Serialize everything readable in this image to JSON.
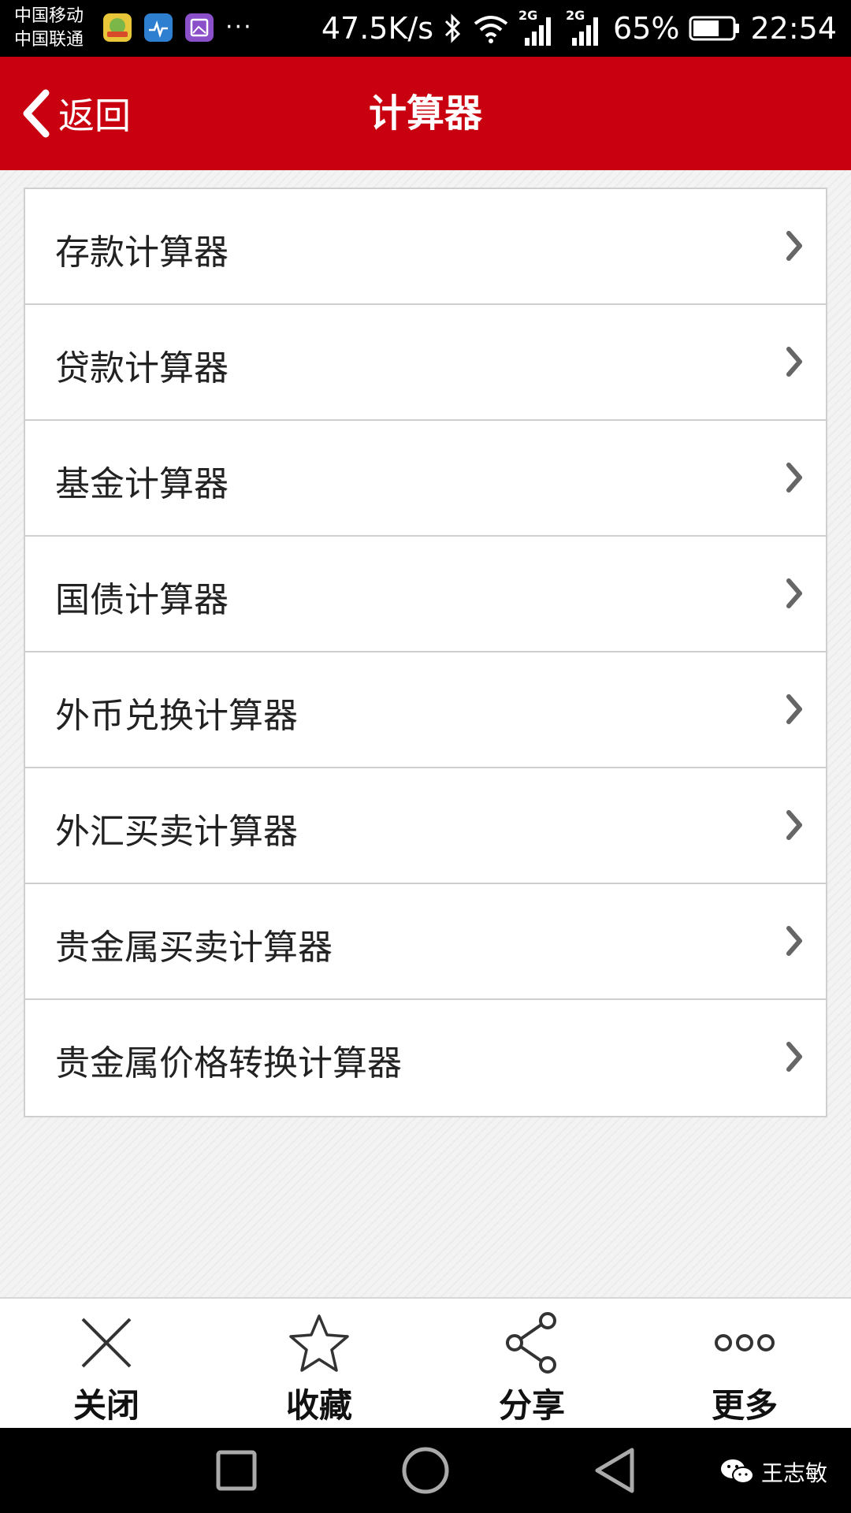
{
  "status_bar": {
    "carrier_1": "中国移动",
    "carrier_2": "中国联通",
    "more_dots": "···",
    "net_speed": "47.5K/s",
    "signal_1_label": "2G",
    "signal_2_label": "2G",
    "battery_percent": "65%",
    "time": "22:54"
  },
  "header": {
    "back_label": "返回",
    "title": "计算器"
  },
  "menu": {
    "items": [
      {
        "label": "存款计算器"
      },
      {
        "label": "贷款计算器"
      },
      {
        "label": "基金计算器"
      },
      {
        "label": "国债计算器"
      },
      {
        "label": "外币兑换计算器"
      },
      {
        "label": "外汇买卖计算器"
      },
      {
        "label": "贵金属买卖计算器"
      },
      {
        "label": "贵金属价格转换计算器"
      }
    ]
  },
  "actions": {
    "close_label": "关闭",
    "favorite_label": "收藏",
    "share_label": "分享",
    "more_label": "更多"
  },
  "watermark": {
    "text": "王志敏"
  },
  "colors": {
    "header_bg": "#c8000f",
    "status_bg": "#000000",
    "nav_bg": "#000000"
  },
  "icons": {
    "back": "chevron-left-icon",
    "item_arrow": "chevron-right-icon",
    "close": "close-icon",
    "favorite": "star-icon",
    "share": "share-icon",
    "more": "more-dots-icon",
    "nav_recent": "square-icon",
    "nav_home": "circle-icon",
    "nav_back": "triangle-back-icon",
    "wechat": "wechat-icon"
  }
}
